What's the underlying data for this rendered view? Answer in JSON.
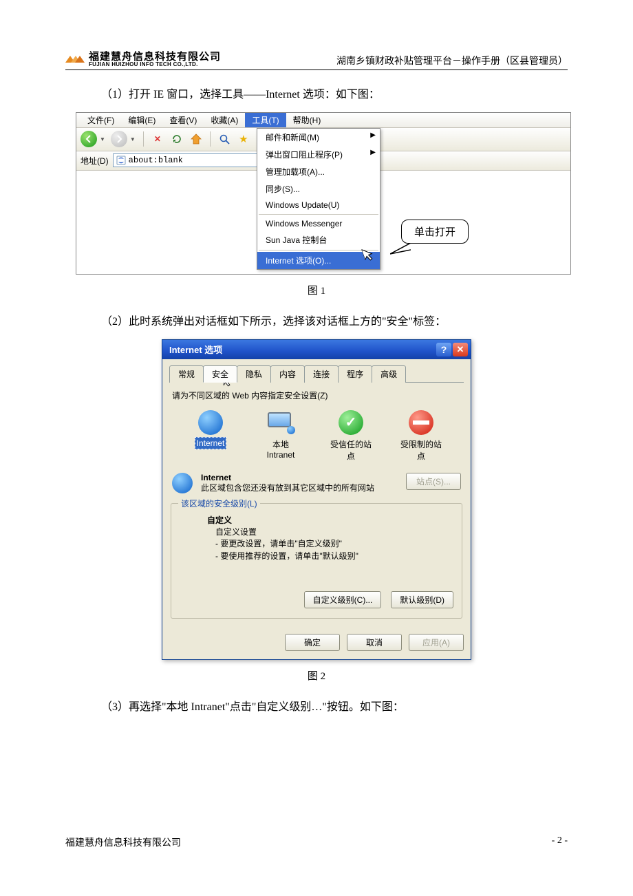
{
  "header": {
    "company_cn": "福建慧舟信息科技有限公司",
    "company_en": "FUJIAN HUIZHOU INFO TECH CO.,LTD.",
    "doc_title": "湖南乡镇财政补贴管理平台－操作手册（区县管理员）"
  },
  "steps": {
    "s1": "（1）打开 IE 窗口，选择工具——Internet 选项：如下图：",
    "s2": "（2）此时系统弹出对话框如下所示，选择该对话框上方的\"安全\"标签：",
    "s3": "（3）再选择\"本地 Intranet\"点击\"自定义级别…\"按钮。如下图："
  },
  "captions": {
    "fig1": "图 1",
    "fig2": "图 2"
  },
  "ie": {
    "menu": {
      "file": "文件(F)",
      "edit": "编辑(E)",
      "view": "查看(V)",
      "fav": "收藏(A)",
      "tools": "工具(T)",
      "help": "帮助(H)"
    },
    "addr_label": "地址(D)",
    "addr_value": "about:blank",
    "dropdown": {
      "mail": "邮件和新闻(M)",
      "popup": "弹出窗口阻止程序(P)",
      "addons": "管理加载项(A)...",
      "sync": "同步(S)...",
      "wu": "Windows Update(U)",
      "wm": "Windows Messenger",
      "java": "Sun Java 控制台",
      "iopt": "Internet 选项(O)..."
    },
    "callout": "单击打开"
  },
  "dlg": {
    "title": "Internet 选项",
    "tabs": {
      "general": "常规",
      "security": "安全",
      "privacy": "隐私",
      "content": "内容",
      "conn": "连接",
      "programs": "程序",
      "advanced": "高级"
    },
    "zone_instr": "请为不同区域的 Web 内容指定安全设置(Z)",
    "zones": {
      "internet": "Internet",
      "intranet_l1": "本地",
      "intranet_l2": "Intranet",
      "trusted_l1": "受信任的站",
      "trusted_l2": "点",
      "restricted_l1": "受限制的站",
      "restricted_l2": "点"
    },
    "detail": {
      "title": "Internet",
      "desc": "此区域包含您还没有放到其它区域中的所有网站",
      "sites_btn": "站点(S)..."
    },
    "level": {
      "legend": "该区域的安全级别(L)",
      "custom": "自定义",
      "custom_set": "自定义设置",
      "line1": "- 要更改设置，请单击\"自定义级别\"",
      "line2": "- 要使用推荐的设置，请单击\"默认级别\"",
      "btn_custom": "自定义级别(C)...",
      "btn_default": "默认级别(D)"
    },
    "footer": {
      "ok": "确定",
      "cancel": "取消",
      "apply": "应用(A)"
    }
  },
  "footer": {
    "company": "福建慧舟信息科技有限公司",
    "page": "- 2 -"
  }
}
